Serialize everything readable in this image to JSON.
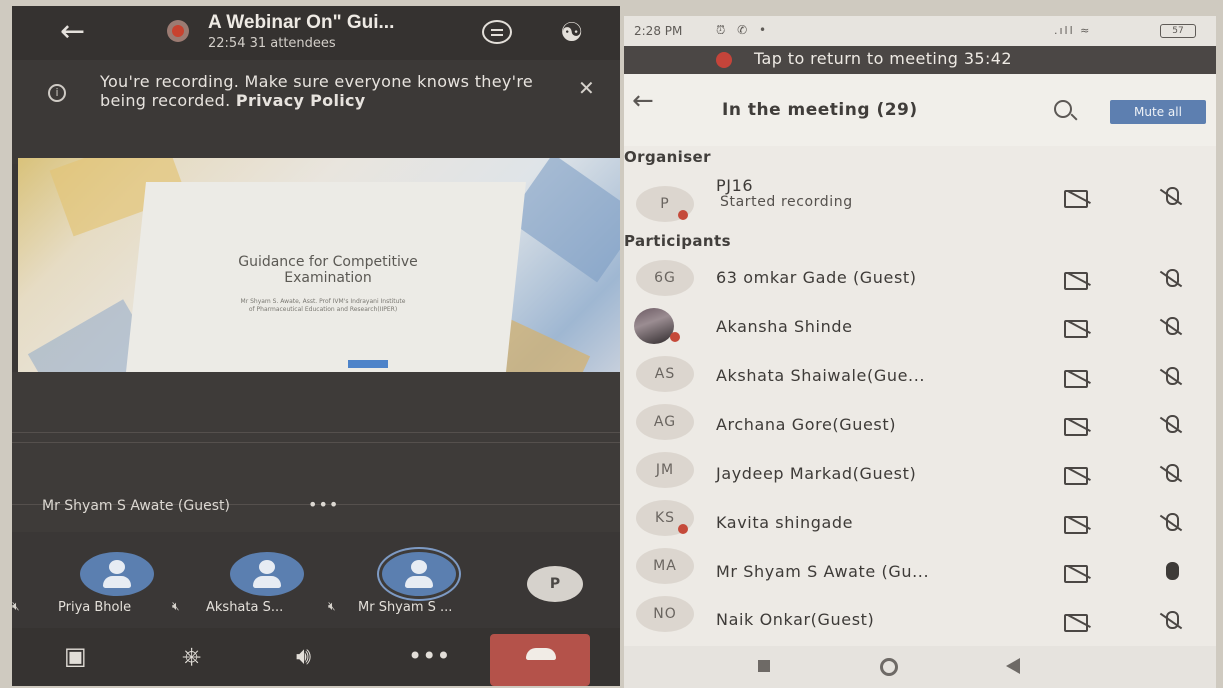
{
  "meeting": {
    "title": "A Webinar On\" Gui...",
    "subtitle": "22:54  31 attendees",
    "banner_text": "You're recording. Make sure everyone knows they're being recorded.",
    "banner_link": "Privacy Policy",
    "slide": {
      "title": "Guidance for Competitive Examination",
      "author": "Mr Shyam S. Awate, Asst. Prof IVM's Indrayani Institute of Pharmaceutical Education and Research(IIPER)"
    },
    "speaker_label": "Mr Shyam S Awate (Guest)",
    "speaker_more": "•••",
    "tiles": [
      {
        "label": "Priya Bhole"
      },
      {
        "label": "Akshata S..."
      },
      {
        "label": "Mr Shyam S ..."
      },
      {
        "initial": "P"
      }
    ]
  },
  "phone": {
    "time": "2:28 PM",
    "battery": "57",
    "return_text": "Tap to return to meeting 35:42"
  },
  "participants_panel": {
    "title": "In the meeting (29)",
    "mute_all": "Mute all",
    "organiser_heading": "Organiser",
    "participants_heading": "Participants",
    "organiser": {
      "initials": "P",
      "name": "PJ16",
      "status": "Started recording"
    },
    "participants": [
      {
        "initials": "6G",
        "name": "63 omkar Gade (Guest)",
        "mic": "muted"
      },
      {
        "initials": "",
        "name": "Akansha Shinde",
        "mic": "muted",
        "photo": true
      },
      {
        "initials": "AS",
        "name": "Akshata Shaiwale(Gue...",
        "mic": "muted"
      },
      {
        "initials": "AG",
        "name": "Archana Gore(Guest)",
        "mic": "muted"
      },
      {
        "initials": "JM",
        "name": "Jaydeep Markad(Guest)",
        "mic": "muted"
      },
      {
        "initials": "KS",
        "name": "Kavita shingade",
        "mic": "muted"
      },
      {
        "initials": "MA",
        "name": "Mr Shyam S Awate (Gu...",
        "mic": "on"
      },
      {
        "initials": "NO",
        "name": "Naik Onkar(Guest)",
        "mic": "muted"
      }
    ]
  },
  "colors": {
    "accent": "#5d7fb0",
    "recording_red": "#c5443a",
    "end_call": "#b4524a"
  },
  "icons": [
    "back-arrow-icon",
    "recording-icon",
    "chat-icon",
    "participants-icon",
    "info-icon",
    "close-icon",
    "camera-off-icon",
    "mic-off-icon",
    "speaker-icon",
    "more-icon",
    "hang-up-icon",
    "search-icon",
    "mic-on-icon"
  ]
}
